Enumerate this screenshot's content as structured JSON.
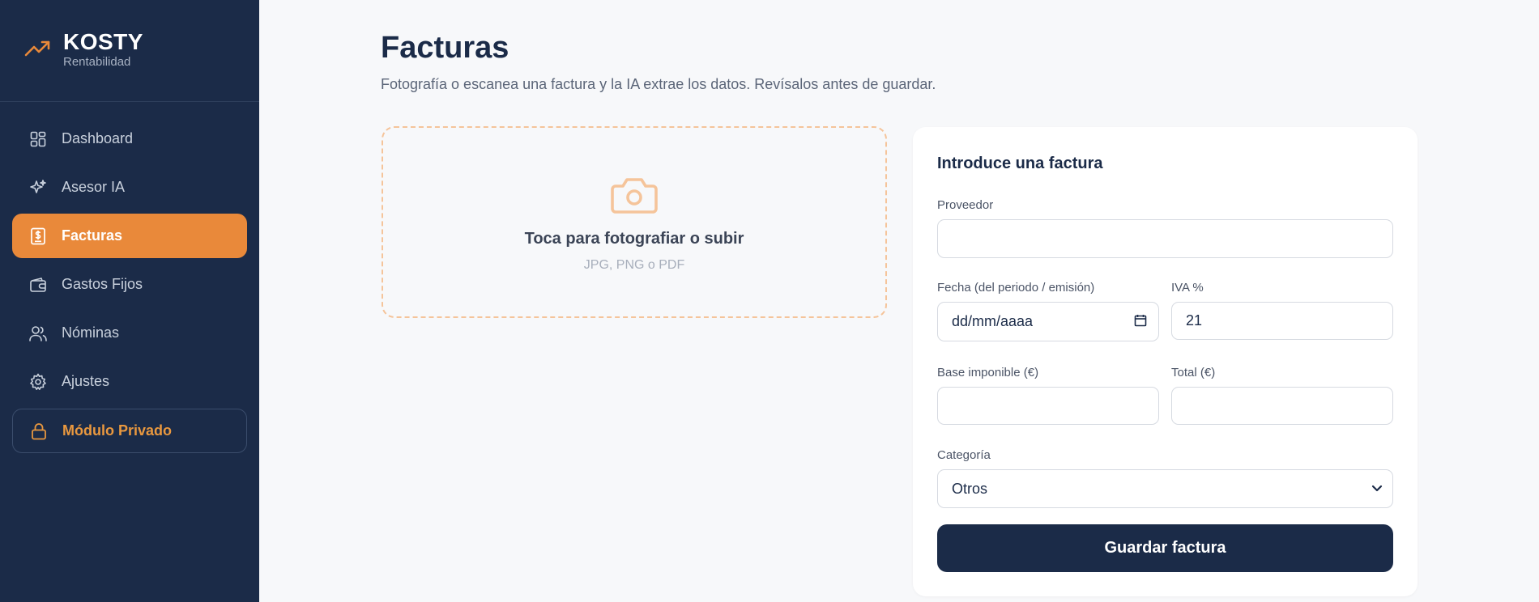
{
  "brand": {
    "name": "KOSTY",
    "subtitle": "Rentabilidad",
    "accent": "#e9893a"
  },
  "sidebar": {
    "items": [
      {
        "label": "Dashboard",
        "icon": "dashboard-grid-icon"
      },
      {
        "label": "Asesor IA",
        "icon": "sparkles-icon"
      },
      {
        "label": "Facturas",
        "icon": "invoice-dollar-icon",
        "active": true
      },
      {
        "label": "Gastos Fijos",
        "icon": "wallet-icon"
      },
      {
        "label": "Nóminas",
        "icon": "users-icon"
      },
      {
        "label": "Ajustes",
        "icon": "gear-icon"
      },
      {
        "label": "Módulo Privado",
        "icon": "lock-icon"
      }
    ]
  },
  "page": {
    "title": "Facturas",
    "subtitle": "Fotografía o escanea una factura y la IA extrae los datos. Revísalos antes de guardar."
  },
  "upload": {
    "icon": "camera-icon",
    "title": "Toca para fotografiar o subir",
    "formats": "JPG, PNG o PDF"
  },
  "form": {
    "title": "Introduce una factura",
    "proveedor_label": "Proveedor",
    "proveedor_value": "",
    "fecha_label": "Fecha (del periodo / emisión)",
    "fecha_placeholder": "dd/mm/aaaa",
    "iva_label": "IVA %",
    "iva_value": "21",
    "base_label": "Base imponible (€)",
    "base_value": "",
    "total_label": "Total (€)",
    "total_value": "",
    "categoria_label": "Categoría",
    "categoria_value": "Otros",
    "save_label": "Guardar factura"
  }
}
